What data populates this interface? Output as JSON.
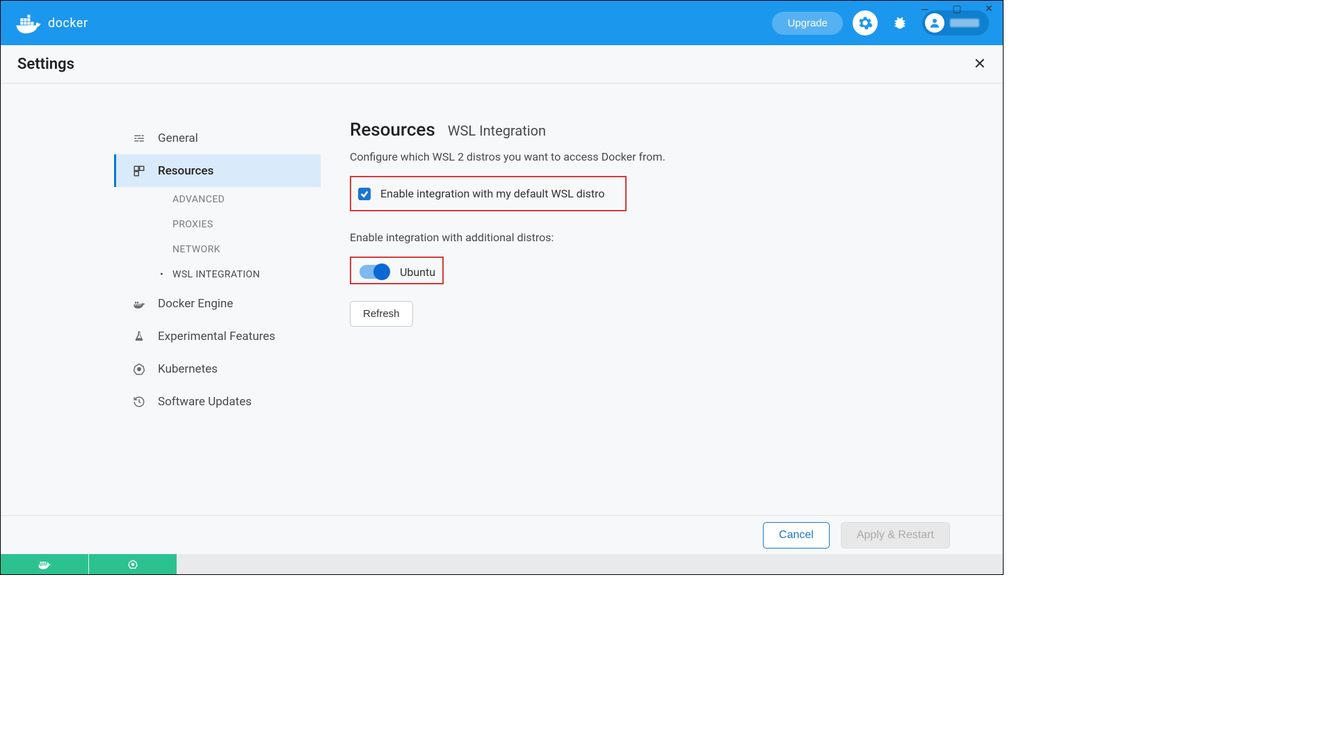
{
  "header": {
    "brand": "docker",
    "upgrade_label": "Upgrade"
  },
  "settings": {
    "title": "Settings"
  },
  "sidebar": {
    "items": [
      {
        "label": "General"
      },
      {
        "label": "Resources"
      },
      {
        "label": "Docker Engine"
      },
      {
        "label": "Experimental Features"
      },
      {
        "label": "Kubernetes"
      },
      {
        "label": "Software Updates"
      }
    ],
    "resources_sub": [
      {
        "label": "ADVANCED"
      },
      {
        "label": "PROXIES"
      },
      {
        "label": "NETWORK"
      },
      {
        "label": "WSL INTEGRATION"
      }
    ]
  },
  "content": {
    "heading_main": "Resources",
    "heading_sub": "WSL Integration",
    "description": "Configure which WSL 2 distros you want to access Docker from.",
    "checkbox_label": "Enable integration with my default WSL distro",
    "additional_label": "Enable integration with additional distros:",
    "distro_name": "Ubuntu",
    "refresh_label": "Refresh"
  },
  "footer": {
    "cancel_label": "Cancel",
    "apply_label": "Apply & Restart"
  }
}
